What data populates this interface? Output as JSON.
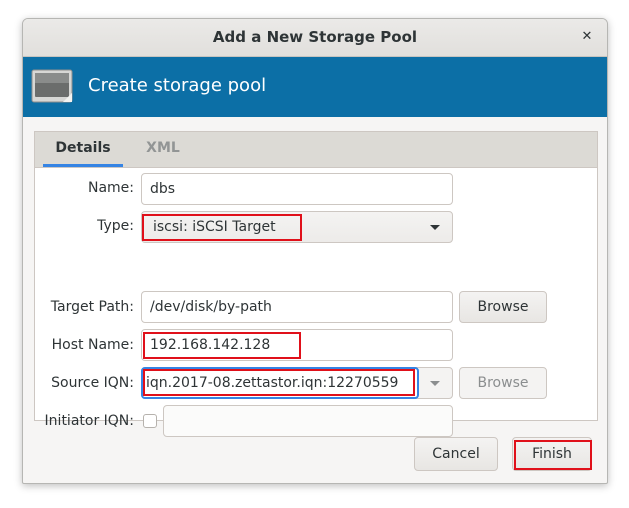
{
  "window": {
    "title": "Add a New Storage Pool",
    "close_glyph": "✕"
  },
  "banner": {
    "title": "Create storage pool",
    "icon": "storage-pool-icon"
  },
  "tabs": [
    {
      "label": "Details",
      "active": true
    },
    {
      "label": "XML",
      "active": false
    }
  ],
  "form": {
    "name_label": "Name:",
    "name_value": "dbs",
    "type_label": "Type:",
    "type_value": "iscsi: iSCSI Target",
    "target_path_label": "Target Path:",
    "target_path_value": "/dev/disk/by-path",
    "host_name_label": "Host Name:",
    "host_name_value": "192.168.142.128",
    "source_iqn_label": "Source IQN:",
    "source_iqn_value": "iqn.2017-08.zettastor.iqn:12270559",
    "initiator_iqn_label": "Initiator IQN:",
    "initiator_iqn_checked": false,
    "initiator_iqn_value": ""
  },
  "buttons": {
    "browse_target": "Browse",
    "browse_source": "Browse",
    "cancel": "Cancel",
    "finish": "Finish"
  },
  "colors": {
    "banner": "#0c6fa6",
    "highlight": "#e0101a",
    "focus": "#3584e4"
  }
}
